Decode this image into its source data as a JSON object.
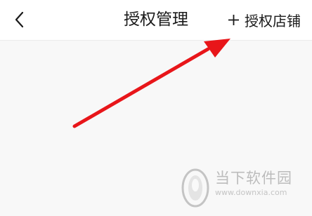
{
  "header": {
    "title": "授权管理",
    "back_icon": "chevron-left-icon",
    "add_icon": "plus-icon",
    "add_label": "授权店铺"
  },
  "annotation": {
    "arrow_color": "#e8161a"
  },
  "watermark": {
    "text": "当下软件园",
    "url": "www.downxia.com"
  },
  "colors": {
    "navbar_bg": "#ffffff",
    "page_bg": "#f8f8f8",
    "text": "#1a1a1a"
  }
}
